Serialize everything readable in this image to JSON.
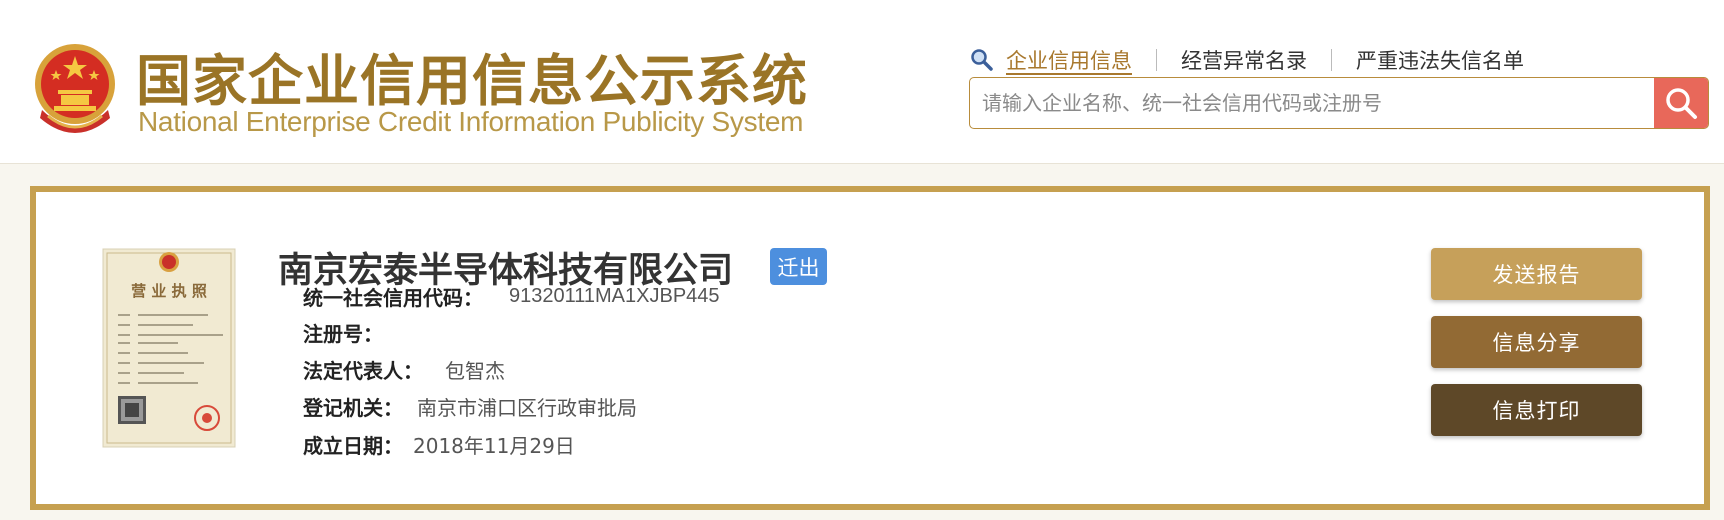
{
  "header": {
    "title_cn": "国家企业信用信息公示系统",
    "title_en": "National Enterprise Credit Information Publicity System",
    "emblem_icon": "national-emblem-icon",
    "nav": {
      "search_icon": "magnifier-icon",
      "items": [
        {
          "label": "企业信用信息",
          "active": true
        },
        {
          "label": "经营异常名录",
          "active": false
        },
        {
          "label": "严重违法失信名单",
          "active": false
        }
      ]
    },
    "search": {
      "value": "",
      "placeholder": "请输入企业名称、统一社会信用代码或注册号",
      "button_icon": "search-icon",
      "button_color": "#e8685a"
    }
  },
  "company": {
    "name": "南京宏泰半导体科技有限公司",
    "status": "迁出",
    "status_color": "#4d8fde",
    "license_image": "business-license-thumbnail",
    "license_text": "营 业 执 照",
    "fields": [
      {
        "label": "统一社会信用代码：",
        "value": "91320111MA1XJBP445"
      },
      {
        "label": "注册号：",
        "value": ""
      },
      {
        "label": "法定代表人：",
        "value": "包智杰"
      },
      {
        "label": "登记机关：",
        "value": "南京市浦口区行政审批局"
      },
      {
        "label": "成立日期：",
        "value": "2018年11月29日"
      }
    ]
  },
  "actions": [
    {
      "label": "发送报告",
      "color": "#c6a05a"
    },
    {
      "label": "信息分享",
      "color": "#926a34"
    },
    {
      "label": "信息打印",
      "color": "#5e4828"
    }
  ],
  "colors": {
    "brand_gold": "#9a7426",
    "card_border": "#c6a050",
    "page_bg": "#f8f6ef"
  }
}
